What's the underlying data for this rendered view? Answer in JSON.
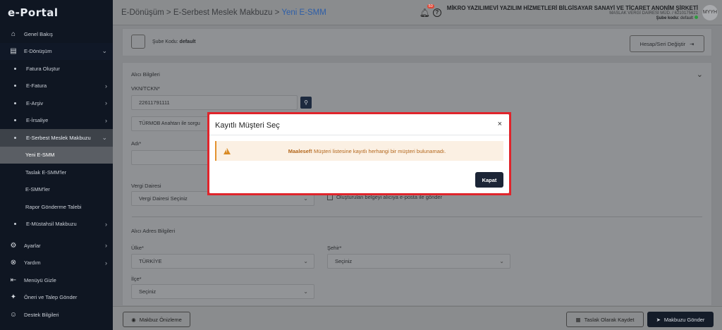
{
  "app": {
    "logo": "e-Portal"
  },
  "sidebar": {
    "items": [
      {
        "label": "Genel Bakış",
        "icon": "home-icon",
        "glyph": "⌂"
      },
      {
        "label": "E-Dönüşüm",
        "icon": "document-icon",
        "glyph": "▤",
        "chev": "⌄"
      },
      {
        "label": "Fatura Oluştur"
      },
      {
        "label": "E-Fatura",
        "chev": "›"
      },
      {
        "label": "E-Arşiv",
        "chev": "›"
      },
      {
        "label": "E-İrsaliye",
        "chev": "›"
      },
      {
        "label": "E-Serbest Meslek Makbuzu",
        "chev": "⌄"
      },
      {
        "label": "Yeni E-SMM"
      },
      {
        "label": "Taslak E-SMM'ler"
      },
      {
        "label": "E-SMM'ler"
      },
      {
        "label": "Rapor Gönderme Talebi"
      },
      {
        "label": "E-Müstahsil Makbuzu",
        "chev": "›"
      },
      {
        "label": "Ayarlar",
        "icon": "gear-icon",
        "glyph": "⚙",
        "chev": "›"
      },
      {
        "label": "Yardım",
        "icon": "lifebuoy-icon",
        "glyph": "⊗",
        "chev": "›"
      },
      {
        "label": "Menüyü Gizle",
        "icon": "collapse-menu-icon",
        "glyph": "⇤"
      },
      {
        "label": "Öneri ve Talep Gönder",
        "icon": "lightbulb-icon",
        "glyph": "✦"
      },
      {
        "label": "Destek Bilgileri",
        "icon": "support-icon",
        "glyph": "☺"
      }
    ]
  },
  "header": {
    "breadcrumb": [
      "E-Dönüşüm",
      "E-Serbest Meslek Makbuzu",
      "Yeni E-SMM"
    ],
    "separator": " > ",
    "notification_count": "50",
    "company_name": "MİKRO YAZILIMEVİ YAZILIM HİZMETLERİ BİLGİSAYAR SANAYİ VE TİCARET ANONİM ŞİRKETİ",
    "tax_info": "MASLAK VERGİ DAİRESİ MÜD. / 6210175621",
    "branch_label": "Şube kodu:",
    "branch_value": "default",
    "avatar": "MYYH"
  },
  "main": {
    "sube_label": "Şube Kodu:",
    "sube_value": "default",
    "hesap_button": "Hesap/Seri Değiştir",
    "alici_title": "Alıcı Bilgileri",
    "vkn_label": "VKN/TCKN*",
    "vkn_value": "22611791111",
    "turmob_button": "TÜRMOB Anahtarı ile sorgu",
    "adi_label": "Adı*",
    "vergi_dairesi_label": "Vergi Dairesi",
    "vergi_dairesi_value": "Vergi Dairesi Seçiniz",
    "email_checkbox": "Oluşturulan belgeyi alıcıya e-posta ile gönder",
    "adres_title": "Alıcı Adres Bilgileri",
    "ulke_label": "Ülke*",
    "ulke_value": "TÜRKİYE",
    "sehir_label": "Şehir*",
    "sehir_value": "Seçiniz",
    "ilce_label": "İlçe*",
    "ilce_value": "Seçiniz"
  },
  "bottom": {
    "preview_button": "Makbuz Önizleme",
    "draft_button": "Taslak Olarak Kaydet",
    "send_button": "Makbuzu Gönder"
  },
  "modal": {
    "title": "Kayıtlı Müşteri Seç",
    "alert_bold": "Maalesef!",
    "alert_text": " Müşteri listesine kayıtlı herhangi bir müşteri bulunamadı.",
    "close_button": "Kapat",
    "highlight_color": "#e0242b"
  }
}
